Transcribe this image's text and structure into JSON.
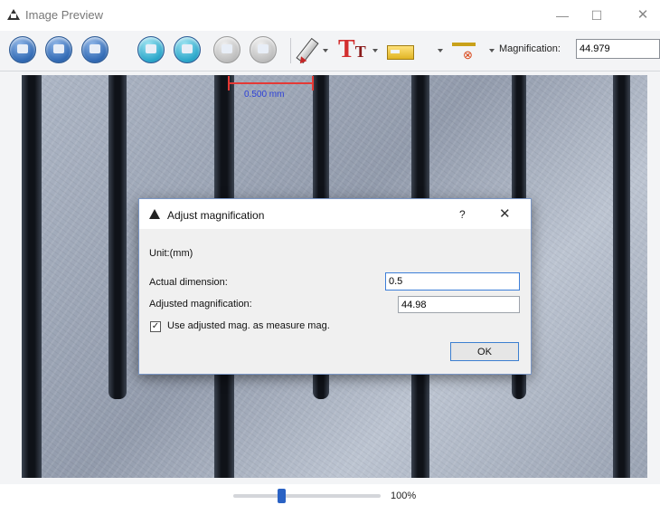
{
  "window": {
    "title": "Image Preview",
    "controls": {
      "minimize": "—",
      "maximize": "☐",
      "close": "✕"
    }
  },
  "toolbar": {
    "buttons": [
      {
        "name": "save",
        "icon": "save-icon",
        "color": "blue"
      },
      {
        "name": "open",
        "icon": "open-icon",
        "color": "blue"
      },
      {
        "name": "print",
        "icon": "print-icon",
        "color": "blue"
      },
      {
        "name": "previous",
        "icon": "previous-icon",
        "color": "cyan"
      },
      {
        "name": "next",
        "icon": "next-icon",
        "color": "cyan"
      },
      {
        "name": "undo",
        "icon": "undo-icon",
        "color": "gray"
      },
      {
        "name": "redo",
        "icon": "redo-icon",
        "color": "gray"
      }
    ],
    "tools": [
      {
        "name": "pencil",
        "icon": "pencil-icon"
      },
      {
        "name": "text",
        "icon": "text-tool-icon",
        "glyph": "T",
        "glyph_small": "T"
      },
      {
        "name": "ruler",
        "icon": "ruler-icon"
      },
      {
        "name": "angle",
        "icon": "angle-measure-icon"
      }
    ],
    "magnification_label": "Magnification:",
    "magnification_value": "44.979"
  },
  "image": {
    "measurement_label": "0.500 mm",
    "measurement_color": "#e53935"
  },
  "zoom": {
    "value": "100%",
    "level_fraction": 0.33
  },
  "dialog": {
    "title": "Adjust magnification",
    "help": "?",
    "close": "✕",
    "unit_label": "Unit:(mm)",
    "actual_dimension_label": "Actual dimension:",
    "actual_dimension_value": "0.5",
    "adjusted_magnification_label": "Adjusted magnification:",
    "adjusted_magnification_value": "44.98",
    "checkbox_label": "Use adjusted mag. as measure mag.",
    "checkbox_checked": true,
    "checkbox_mark": "✓",
    "ok_label": "OK"
  },
  "colors": {
    "accent": "#2a62c4",
    "dialog_border": "#7b97c6",
    "measurement_text": "#2b3fd8"
  }
}
